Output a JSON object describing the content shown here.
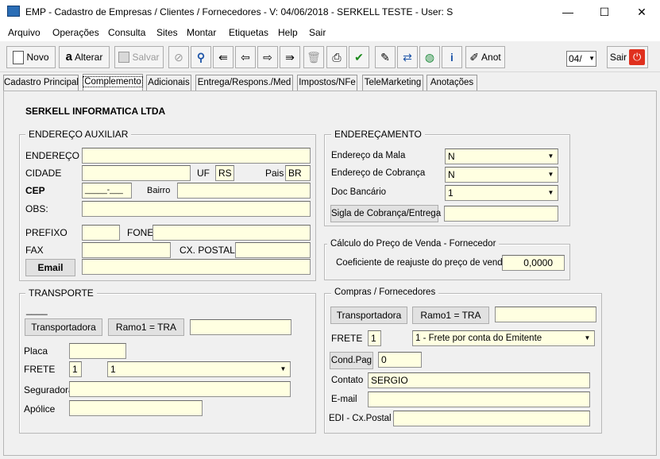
{
  "window": {
    "title": "EMP - Cadastro de Empresas / Clientes / Fornecedores - V: 04/06/2018 - SERKELL TESTE - User: S",
    "minimize": "—",
    "maximize": "☐",
    "close": "✕"
  },
  "menu": [
    "Arquivo",
    "Operações",
    "Consulta",
    "Sites",
    "Montar",
    "Etiquetas",
    "Help",
    "Sair"
  ],
  "toolbar": {
    "novo": "Novo",
    "alterar": "Alterar",
    "salvar": "Salvar",
    "anot": "Anot",
    "page_select": "04/",
    "sair": "Sair"
  },
  "tabs": [
    "Cadastro Principal",
    "Complemento",
    "Adicionais",
    "Entrega/Respons./Med",
    "Impostos/NFe",
    "TeleMarketing",
    "Anotações"
  ],
  "company_name": "SERKELL INFORMATICA LTDA",
  "endereco_auxiliar": {
    "title": "ENDEREÇO AUXILIAR",
    "endereco_label": "ENDEREÇO",
    "endereco": "",
    "cidade_label": "CIDADE",
    "cidade": "",
    "uf_label": "UF",
    "uf": "RS",
    "pais_label": "Pais",
    "pais": "BR",
    "cep_label": "CEP",
    "cep": "_____-___",
    "bairro_label": "Bairro",
    "bairro": "",
    "obs_label": "OBS:",
    "obs": "",
    "prefixo_label": "PREFIXO",
    "prefixo": "",
    "fone_label": "FONE",
    "fone": "",
    "fax_label": "FAX",
    "fax": "",
    "cxpostal_label": "CX. POSTAL",
    "cxpostal": "",
    "email_btn": "Email",
    "email": ""
  },
  "enderecamento": {
    "title": "ENDEREÇAMENTO",
    "mala_label": "Endereço da Mala",
    "mala": "N",
    "cobranca_label": "Endereço de Cobrança",
    "cobranca": "N",
    "doc_label": "Doc Bancário",
    "doc": "1",
    "sigla_btn": "Sigla de Cobrança/Entrega",
    "sigla": ""
  },
  "calculo": {
    "title": "Cálculo do Preço de Venda - Fornecedor",
    "coef_label": "Coeficiente de reajuste do preço de venda",
    "coef": "0,0000"
  },
  "transporte": {
    "title": "TRANSPORTE",
    "dash": "____",
    "transportadora_btn": "Transportadora",
    "ramo_btn": "Ramo1 = TRA",
    "ramo": "",
    "placa_label": "Placa",
    "placa": "",
    "frete_label": "FRETE",
    "frete_code": "1",
    "frete": "1",
    "seguradora_label": "Seguradora",
    "seguradora": "",
    "apolice_label": "Apólice",
    "apolice": ""
  },
  "compras": {
    "title": "Compras / Fornecedores",
    "transportadora_btn": "Transportadora",
    "ramo_btn": "Ramo1 = TRA",
    "ramo": "",
    "frete_label": "FRETE",
    "frete_code": "1",
    "frete": "1 - Frete por conta do Emitente",
    "condpag_btn": "Cond.Pag",
    "condpag": "0",
    "contato_label": "Contato",
    "contato": "SERGIO",
    "email_label": "E-mail",
    "email": "",
    "edi_label": "EDI - Cx.Postal",
    "edi": ""
  }
}
